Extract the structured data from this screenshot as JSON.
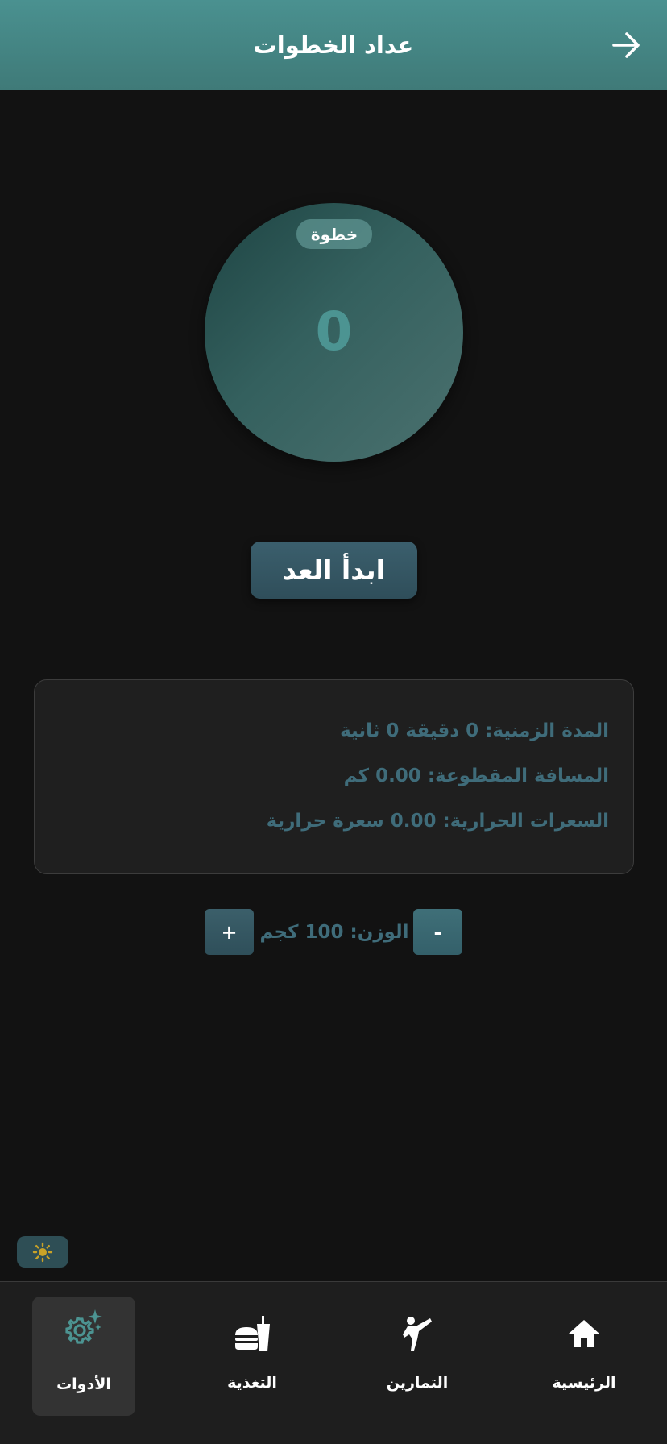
{
  "header": {
    "title": "عداد الخطوات",
    "back_icon": "arrow-right-icon"
  },
  "counter": {
    "label": "خطوة",
    "steps": "0"
  },
  "start_button": {
    "label": "ابدأ العد"
  },
  "stats": {
    "duration": "المدة الزمنية: 0 دقيقة 0 ثانية",
    "distance": "المسافة المقطوعة: 0.00 كم",
    "calories": "السعرات الحرارية: 0.00 سعرة حرارية"
  },
  "weight": {
    "label": "الوزن: 100 كجم",
    "minus_label": "-",
    "plus_label": "+"
  },
  "theme_toggle": {
    "icon": "sun-icon"
  },
  "bottom_nav": {
    "items": [
      {
        "label": "الرئيسية",
        "icon": "home-icon",
        "active": false
      },
      {
        "label": "التمارين",
        "icon": "martial-arts-icon",
        "active": false
      },
      {
        "label": "التغذية",
        "icon": "food-drink-icon",
        "active": false
      },
      {
        "label": "الأدوات",
        "icon": "tools-gear-icon",
        "active": true
      }
    ]
  },
  "colors": {
    "header_bg": "#4a9190",
    "accent": "#4c9492",
    "stat_text": "#3f6c7a",
    "background": "#121212"
  }
}
